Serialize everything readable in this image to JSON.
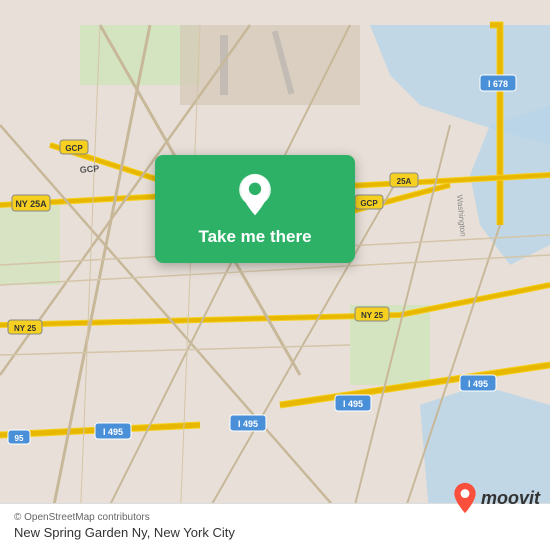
{
  "map": {
    "background_color": "#e8e0d8",
    "center_lat": 40.73,
    "center_lng": -73.86
  },
  "card": {
    "label": "Take me there",
    "background_color": "#2db167"
  },
  "bottom_bar": {
    "copyright": "© OpenStreetMap contributors",
    "location_name": "New Spring Garden Ny, New York City"
  },
  "moovit": {
    "label": "moovit"
  },
  "icons": {
    "pin": "location-pin-icon",
    "moovit_pin": "moovit-pin-icon"
  }
}
